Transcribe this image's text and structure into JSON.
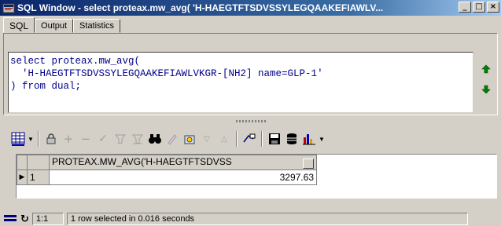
{
  "window": {
    "title": "SQL Window - select proteax.mw_avg( 'H-HAEGTFTSDVSSYLEGQAAKEFIAWLV...",
    "minimize": "_",
    "maximize": "□",
    "close": "×"
  },
  "tabs": [
    {
      "label": "SQL",
      "active": true
    },
    {
      "label": "Output",
      "active": false
    },
    {
      "label": "Statistics",
      "active": false
    }
  ],
  "editor": {
    "line1": "select proteax.mw_avg(",
    "line2": "  'H-HAEGTFTSDVSSYLEGQAAKEFIAWLVKGR-[NH2] name=GLP-1'",
    "line3": ") from dual;"
  },
  "grid": {
    "column_header": "PROTEAX.MW_AVG('H-HAEGTFTSDVSS",
    "rows": [
      {
        "row_number": "1",
        "value": "3297.63"
      }
    ]
  },
  "status": {
    "position": "1:1",
    "message": "1 row selected in 0.016 seconds"
  },
  "colors": {
    "title_gradient_start": "#0a246a",
    "editor_text": "#00008b",
    "face": "#d4d0c8"
  }
}
